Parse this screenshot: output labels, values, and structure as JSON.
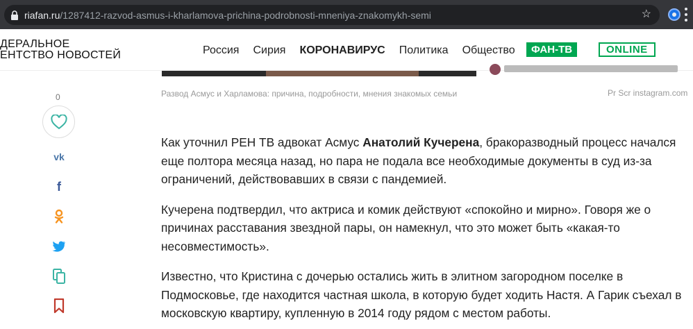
{
  "browser": {
    "url_host": "riafan.ru",
    "url_path": "/1287412-razvod-asmus-i-kharlamova-prichina-podrobnosti-mneniya-znakomykh-semi"
  },
  "header": {
    "logo_line1": "ДЕРАЛЬНОЕ",
    "logo_line2": "ЕНТСТВО НОВОСТЕЙ",
    "nav": [
      "Россия",
      "Сирия",
      "КОРОНАВИРУС",
      "Политика",
      "Общество"
    ],
    "fan_tv": "ФАН-ТВ",
    "online": "ONLINE"
  },
  "photo": {
    "caption": "Развод Асмус и Харламова: причина, подробности, мнения знакомых семьи",
    "credit": "Pr Scr instagram.com"
  },
  "share": {
    "like_count": "0",
    "icons": [
      "vk-icon",
      "facebook-icon",
      "odnoklassniki-icon",
      "twitter-icon",
      "copy-icon",
      "bookmark-icon"
    ]
  },
  "article": {
    "p1_before": "Как уточнил РЕН ТВ адвокат Асмус ",
    "p1_bold": "Анатолий Кучерена",
    "p1_after": ", бракоразводный процесс начался еще полтора месяца назад, но пара не подала все необходимые документы в суд из-за ограничений, действовавших в связи с пандемией.",
    "p2": "Кучерена подтвердил, что актриса и комик действуют «спокойно и мирно». Говоря же о причинах расставания звездной пары, он намекнул, что это может быть «какая-то несовместимость».",
    "p3": "Известно, что Кристина с дочерью остались жить в элитном загородном поселке в Подмосковье, где находится частная школа, в которую будет ходить Настя. А Гарик съехал в московскую квартиру, купленную в 2014 году рядом с местом работы."
  },
  "colors": {
    "accent_green": "#00a651",
    "heart_teal": "#3bb4a4",
    "vk_blue": "#4a76a8",
    "ok_orange": "#f7931e",
    "twitter_blue": "#1da1f2",
    "bookmark_red": "#c0392b"
  }
}
